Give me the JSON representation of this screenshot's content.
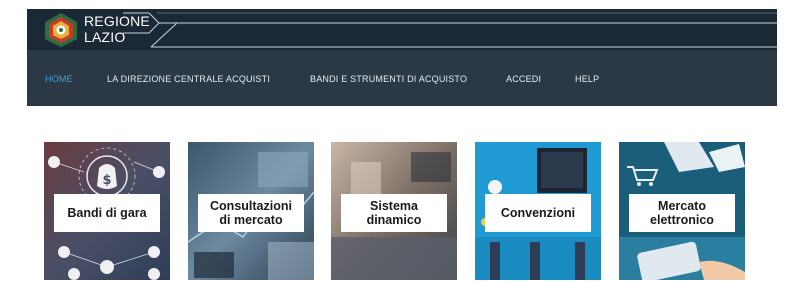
{
  "brand": {
    "line1": "REGIONE",
    "line2": "LAZIO",
    "colors": {
      "topbar": "#1b2836",
      "navbar": "#2b3846",
      "active": "#3fa3d8"
    }
  },
  "nav": {
    "items": [
      {
        "label": "HOME",
        "active": true
      },
      {
        "label": "LA DIREZIONE CENTRALE ACQUISTI",
        "active": false
      },
      {
        "label": "BANDI E STRUMENTI DI ACQUISTO",
        "active": false
      },
      {
        "label": "ACCEDI",
        "active": false
      },
      {
        "label": "HELP",
        "active": false
      }
    ]
  },
  "tiles": [
    {
      "label": "Bandi di gara",
      "icon": "money-bag-network-icon"
    },
    {
      "label": "Consultazioni\ndi mercato",
      "icon": "market-consult-icon"
    },
    {
      "label": "Sistema\ndinamico",
      "icon": "dynamic-system-icon"
    },
    {
      "label": "Convenzioni",
      "icon": "agreements-icon"
    },
    {
      "label": "Mercato\nelettronico",
      "icon": "e-market-cart-icon"
    }
  ]
}
